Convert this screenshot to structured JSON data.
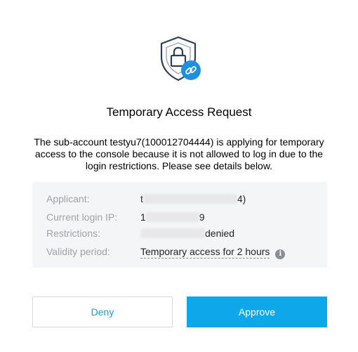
{
  "dialog": {
    "title": "Temporary Access Request",
    "description": "The sub-account testyu7(100012704444) is applying for temporary access to the console because it is not allowed to log in due to the login restrictions. Please see details below.",
    "icon": "shield-lock-link-icon",
    "colors": {
      "accent": "#0ea7e9",
      "shield_stroke": "#2e3f55",
      "link_badge": "#1f8fe0"
    }
  },
  "details": {
    "applicant": {
      "label": "Applicant:",
      "value_start": "t",
      "value_end": "4)"
    },
    "current_login_ip": {
      "label": "Current login IP:",
      "value_start": "1",
      "value_end": "9"
    },
    "restrictions": {
      "label": "Restrictions:",
      "value_end": "denied"
    },
    "validity_period": {
      "label": "Validity period:",
      "value": "Temporary access for 2 hours",
      "info_icon": "info-icon"
    }
  },
  "actions": {
    "deny_label": "Deny",
    "approve_label": "Approve"
  }
}
